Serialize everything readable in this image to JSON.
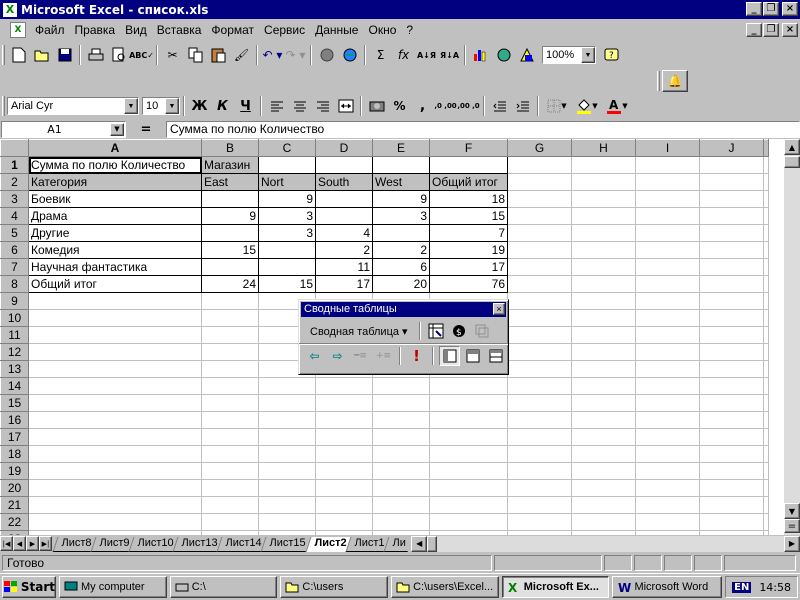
{
  "app": {
    "title": "Microsoft Excel - список.xls"
  },
  "menu": [
    "Файл",
    "Правка",
    "Вид",
    "Вставка",
    "Формат",
    "Сервис",
    "Данные",
    "Окно",
    "?"
  ],
  "toolbar": {
    "zoom": "100%",
    "font_name": "Arial Cyr",
    "font_size": "10",
    "bold": "Ж",
    "italic": "К",
    "underline": "Ч",
    "percent": "%",
    "comma": ",",
    "sum": "Σ",
    "fx": "fx"
  },
  "formula_bar": {
    "name_box": "A1",
    "equals": "=",
    "content": "Сумма по полю Количество"
  },
  "sheet": {
    "columns": [
      "A",
      "B",
      "C",
      "D",
      "E",
      "F",
      "G",
      "H",
      "I",
      "J"
    ],
    "row_numbers": [
      "1",
      "2",
      "3",
      "4",
      "5",
      "6",
      "7",
      "8",
      "9",
      "10",
      "11",
      "12",
      "13",
      "14",
      "15",
      "16",
      "17",
      "18",
      "19",
      "20",
      "21",
      "22",
      "23"
    ],
    "rows": [
      [
        "Сумма по полю Количество",
        "Магазин",
        "",
        "",
        "",
        ""
      ],
      [
        "Категория",
        "East",
        "Nort",
        "South",
        "West",
        "Общий итог"
      ],
      [
        "Боевик",
        "",
        "9",
        "",
        "9",
        "18"
      ],
      [
        "Драма",
        "9",
        "3",
        "",
        "3",
        "15"
      ],
      [
        "Другие",
        "",
        "3",
        "4",
        "",
        "7"
      ],
      [
        "Комедия",
        "15",
        "",
        "2",
        "2",
        "19"
      ],
      [
        "Научная фантастика",
        "",
        "",
        "11",
        "6",
        "17"
      ],
      [
        "Общий итог",
        "24",
        "15",
        "17",
        "20",
        "76"
      ]
    ]
  },
  "sheet_tabs": [
    "Лист8",
    "Лист9",
    "Лист10",
    "Лист13",
    "Лист14",
    "Лист15",
    "Лист2",
    "Лист1",
    "Ли"
  ],
  "active_tab": "Лист2",
  "status": {
    "text": "Готово"
  },
  "pivot_toolbar": {
    "title": "Сводные таблицы",
    "menu_label": "Сводная таблица",
    "refresh": "!"
  },
  "taskbar": {
    "start": "Start",
    "tasks": [
      "My computer",
      "C:\\",
      "C:\\users",
      "C:\\users\\Excel...",
      "Microsoft Ex...",
      "Microsoft Word"
    ],
    "lang": "EN",
    "clock": "14:58"
  },
  "colors": {
    "title_bar": "#000080",
    "window_bg": "#c0c0c0"
  }
}
